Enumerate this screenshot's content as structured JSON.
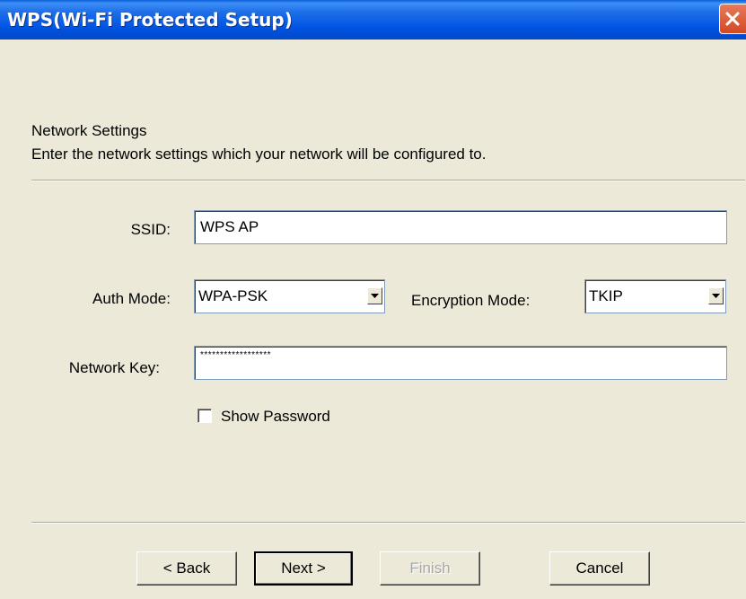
{
  "window": {
    "title": "WPS(Wi-Fi Protected Setup)"
  },
  "page": {
    "heading": "Network Settings",
    "description": "Enter the network settings which your network will be configured to."
  },
  "form": {
    "ssid_label": "SSID:",
    "ssid_value": "WPS AP",
    "auth_label": "Auth Mode:",
    "auth_value": "WPA-PSK",
    "encryption_label": "Encryption Mode:",
    "encryption_value": "TKIP",
    "key_label": "Network Key:",
    "key_value": "******************",
    "show_password_label": "Show Password",
    "show_password_checked": false
  },
  "buttons": {
    "back": "< Back",
    "next": "Next >",
    "finish": "Finish",
    "cancel": "Cancel"
  },
  "icons": {
    "close": "close-icon",
    "dropdown": "chevron-down-icon"
  },
  "colors": {
    "titlebar": "#0054e3",
    "dialog_bg": "#ece9d8",
    "close_button": "#d24a22"
  }
}
